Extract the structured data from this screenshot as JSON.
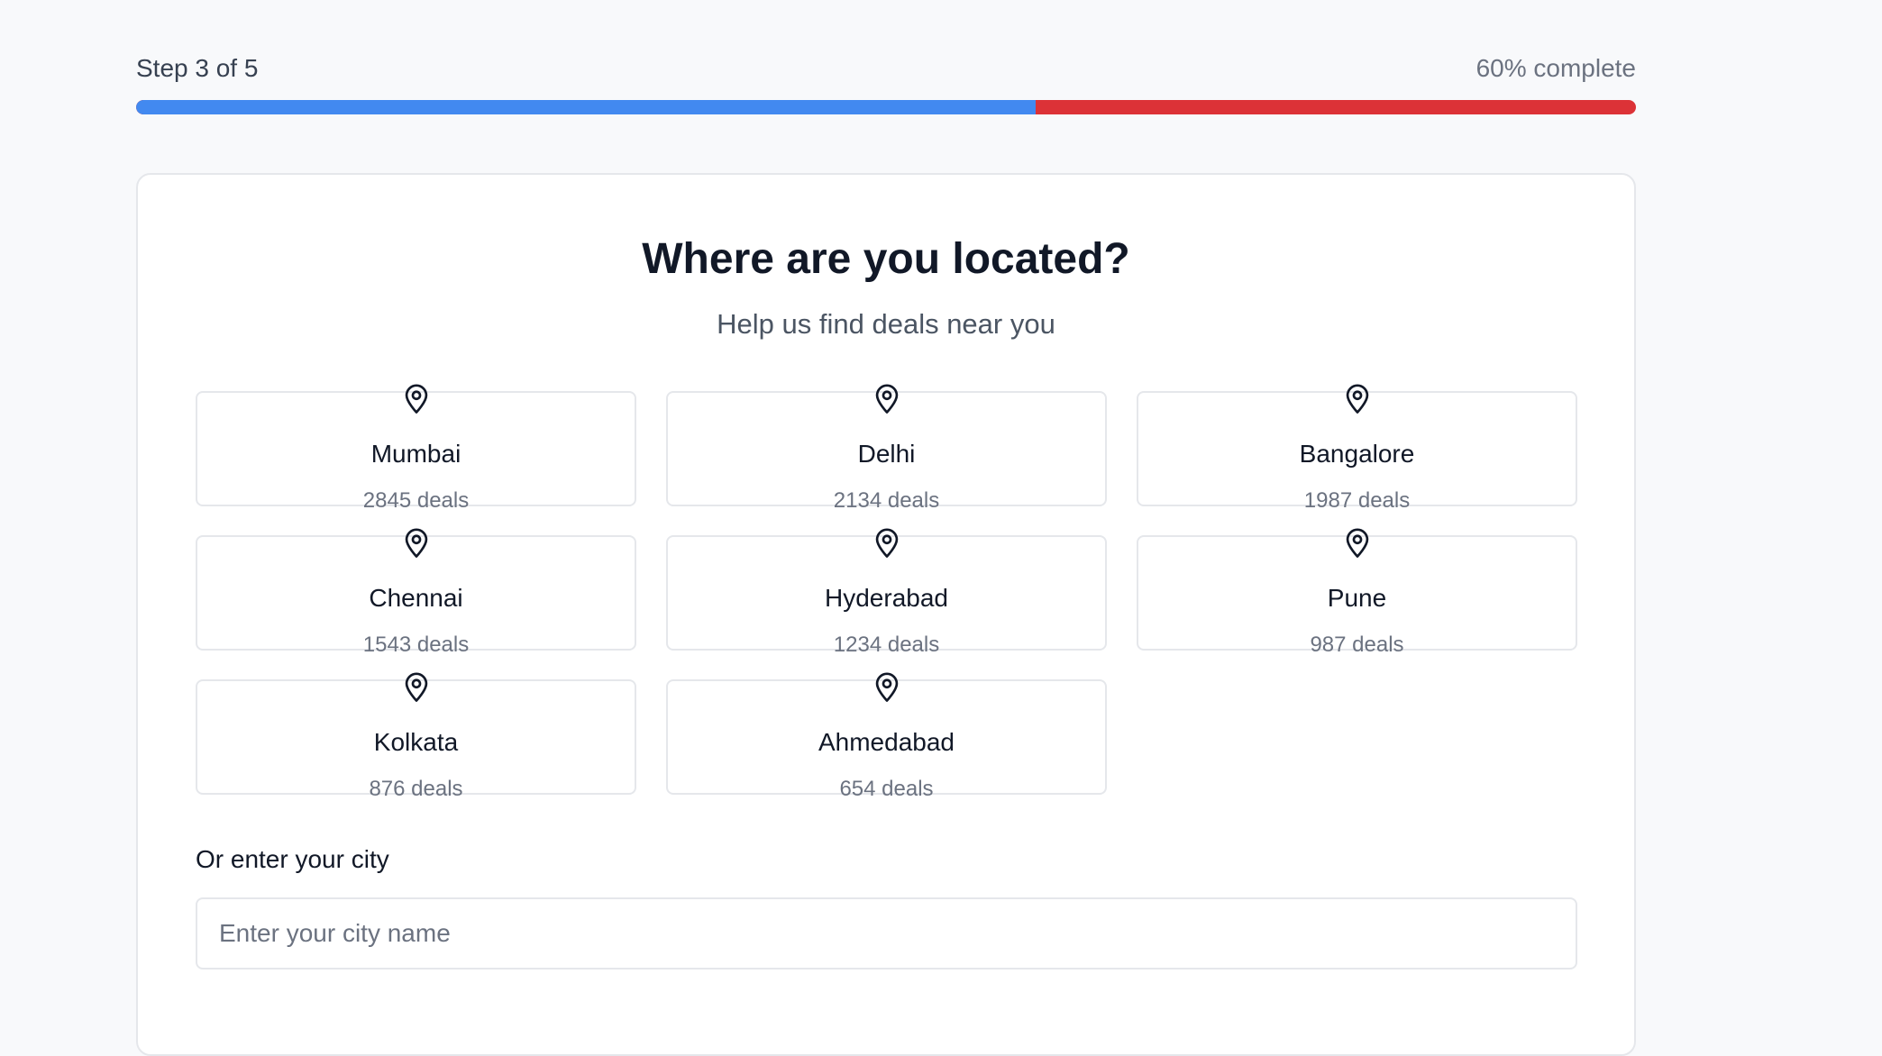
{
  "progress": {
    "step_label": "Step 3 of 5",
    "percent_label": "60% complete",
    "fraction": 0.6,
    "fill_color": "#4289f0",
    "track_color": "#dc3237"
  },
  "card": {
    "title": "Where are you located?",
    "subtitle": "Help us find deals near you"
  },
  "cities": [
    {
      "name": "Mumbai",
      "deals": "2845 deals",
      "icon": "map-pin-icon"
    },
    {
      "name": "Delhi",
      "deals": "2134 deals",
      "icon": "map-pin-icon"
    },
    {
      "name": "Bangalore",
      "deals": "1987 deals",
      "icon": "map-pin-icon"
    },
    {
      "name": "Chennai",
      "deals": "1543 deals",
      "icon": "map-pin-icon"
    },
    {
      "name": "Hyderabad",
      "deals": "1234 deals",
      "icon": "map-pin-icon"
    },
    {
      "name": "Pune",
      "deals": "987 deals",
      "icon": "map-pin-icon"
    },
    {
      "name": "Kolkata",
      "deals": "876 deals",
      "icon": "map-pin-icon"
    },
    {
      "name": "Ahmedabad",
      "deals": "654 deals",
      "icon": "map-pin-icon"
    }
  ],
  "manual_entry": {
    "label": "Or enter your city",
    "placeholder": "Enter your city name",
    "value": ""
  }
}
